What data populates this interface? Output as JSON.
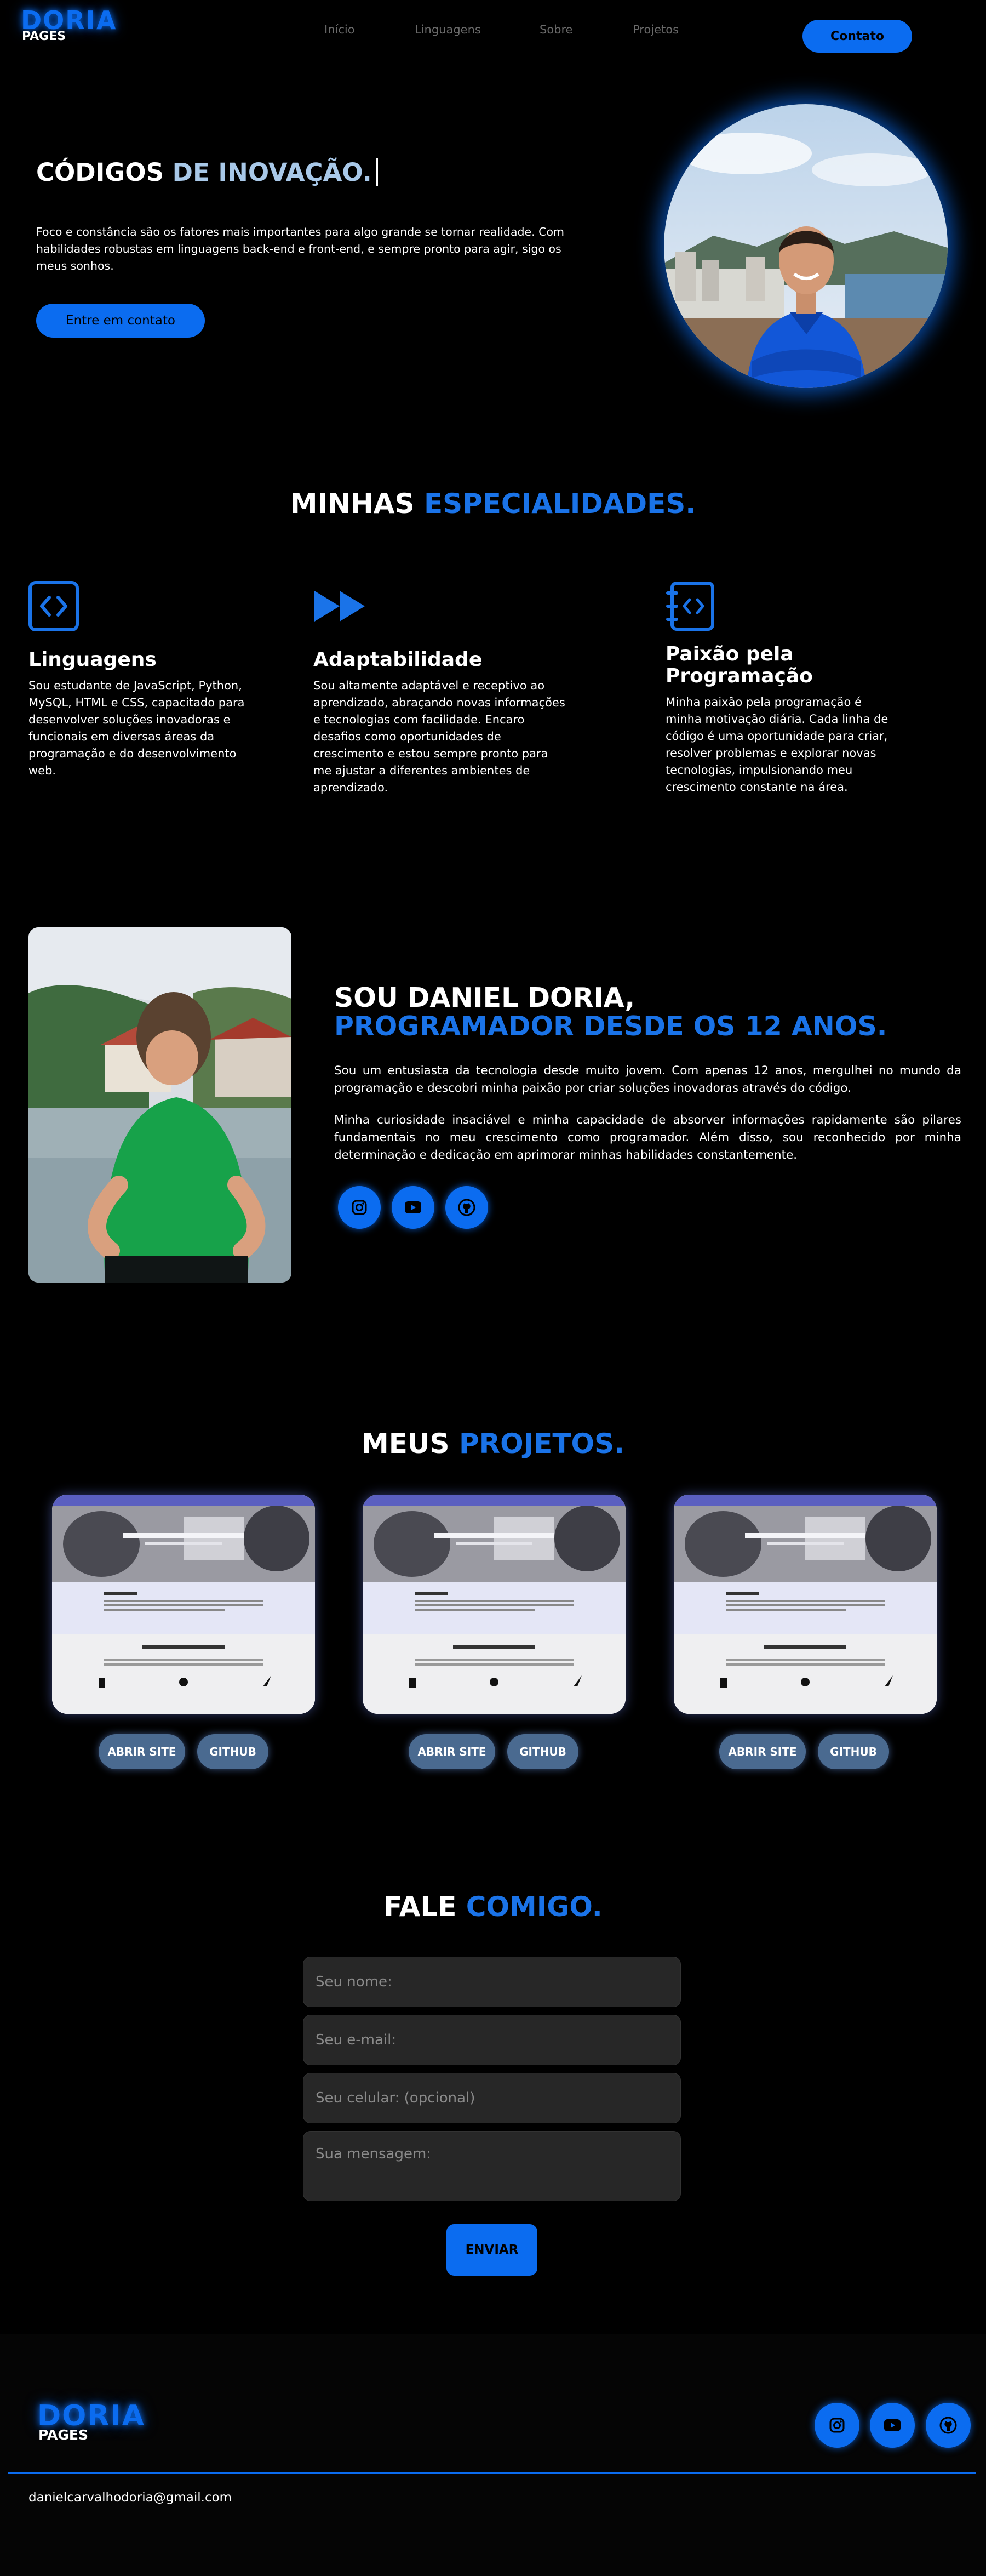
{
  "logo": {
    "big": "DORIA",
    "small": "PAGES"
  },
  "nav": {
    "links": [
      "Início",
      "Linguagens",
      "Sobre",
      "Projetos"
    ],
    "contact_label": "Contato"
  },
  "hero": {
    "title_white": "CÓDIGOS",
    "title_accent": "DE INOVAÇÃO.",
    "text": "Foco e constância são os fatores mais importantes para algo grande se tornar realidade. Com habilidades robustas em linguagens back-end e front-end, e sempre pronto para agir, sigo os meus sonhos.",
    "cta_label": "Entre em contato"
  },
  "specialties": {
    "title_white": "MINHAS",
    "title_accent": "ESPECIALIDADES.",
    "items": [
      {
        "icon": "code-brackets-icon",
        "title": "Linguagens",
        "text": "Sou estudante de JavaScript, Python, MySQL, HTML e CSS, capacitado para desenvolver soluções inovadoras e funcionais em diversas áreas da programação e do desenvolvimento web."
      },
      {
        "icon": "fast-forward-icon",
        "title": "Adaptabilidade",
        "text": "Sou altamente adaptável e receptivo ao aprendizado, abraçando novas informações e tecnologias com facilidade. Encaro desafios como oportunidades de crescimento e estou sempre pronto para me ajustar a diferentes ambientes de aprendizado."
      },
      {
        "icon": "code-notebook-icon",
        "title": "Paixão pela Programação",
        "text": "Minha paixão pela programação é minha motivação diária. Cada linha de código é uma oportunidade para criar, resolver problemas e explorar novas tecnologias, impulsionando meu crescimento constante na área."
      }
    ]
  },
  "about": {
    "line1": "SOU DANIEL DORIA,",
    "line2": "PROGRAMADOR DESDE OS 12 ANOS.",
    "p1": "Sou um entusiasta da tecnologia desde muito jovem. Com apenas 12 anos, mergulhei no mundo da programação e descobri minha paixão por criar soluções inovadoras através do código.",
    "p2": "Minha curiosidade insaciável e minha capacidade de absorver informações rapidamente são pilares fundamentais no meu crescimento como programador. Além disso, sou reconhecido por minha determinação e dedicação em aprimorar minhas habilidades constantemente."
  },
  "projects": {
    "title_white": "MEUS",
    "title_accent": "PROJETOS.",
    "items": [
      {
        "site_label": "ABRIR SITE",
        "github_label": "GITHUB"
      },
      {
        "site_label": "ABRIR SITE",
        "github_label": "GITHUB"
      },
      {
        "site_label": "ABRIR SITE",
        "github_label": "GITHUB"
      }
    ]
  },
  "contact": {
    "title_white": "FALE",
    "title_accent": "COMIGO.",
    "name_placeholder": "Seu nome:",
    "email_placeholder": "Seu e-mail:",
    "phone_placeholder": "Seu celular: (opcional)",
    "message_placeholder": "Sua mensagem:",
    "submit_label": "ENVIAR"
  },
  "footer": {
    "email": "danielcarvalhodoria@gmail.com"
  },
  "colors": {
    "accent": "#0b6cf0",
    "heading_accent": "#1a73e8",
    "hero_accent": "#a8c8e8",
    "background": "#000000"
  }
}
